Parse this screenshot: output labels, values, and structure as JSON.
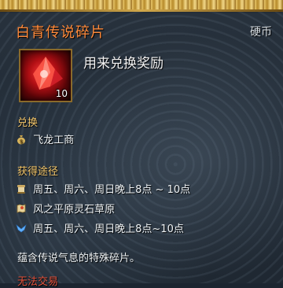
{
  "item": {
    "name": "白青传说碎片",
    "currency_tag": "硬币",
    "description_short": "用来兑换奖励",
    "count": "10",
    "icon": "red-shard-icon",
    "name_color": "#ff8a3a"
  },
  "exchange": {
    "label": "兑换",
    "vendor": "飞龙工商",
    "vendor_icon": "money-bag-icon"
  },
  "obtain": {
    "label": "获得途径",
    "entries": [
      {
        "icon": "scroll-icon",
        "text": "周五、周六、周日晚上8点 ~ 10点"
      },
      {
        "icon": "map-marker-icon",
        "text": "风之平原灵石草原"
      },
      {
        "icon": "wings-icon",
        "text": "周五、周六、周日晚上8点~10点"
      }
    ]
  },
  "lore": "蕴含传说气息的特殊碎片。",
  "trade_status": "无法交易",
  "colors": {
    "section_label": "#f3c66a",
    "warning": "#e0503a"
  }
}
